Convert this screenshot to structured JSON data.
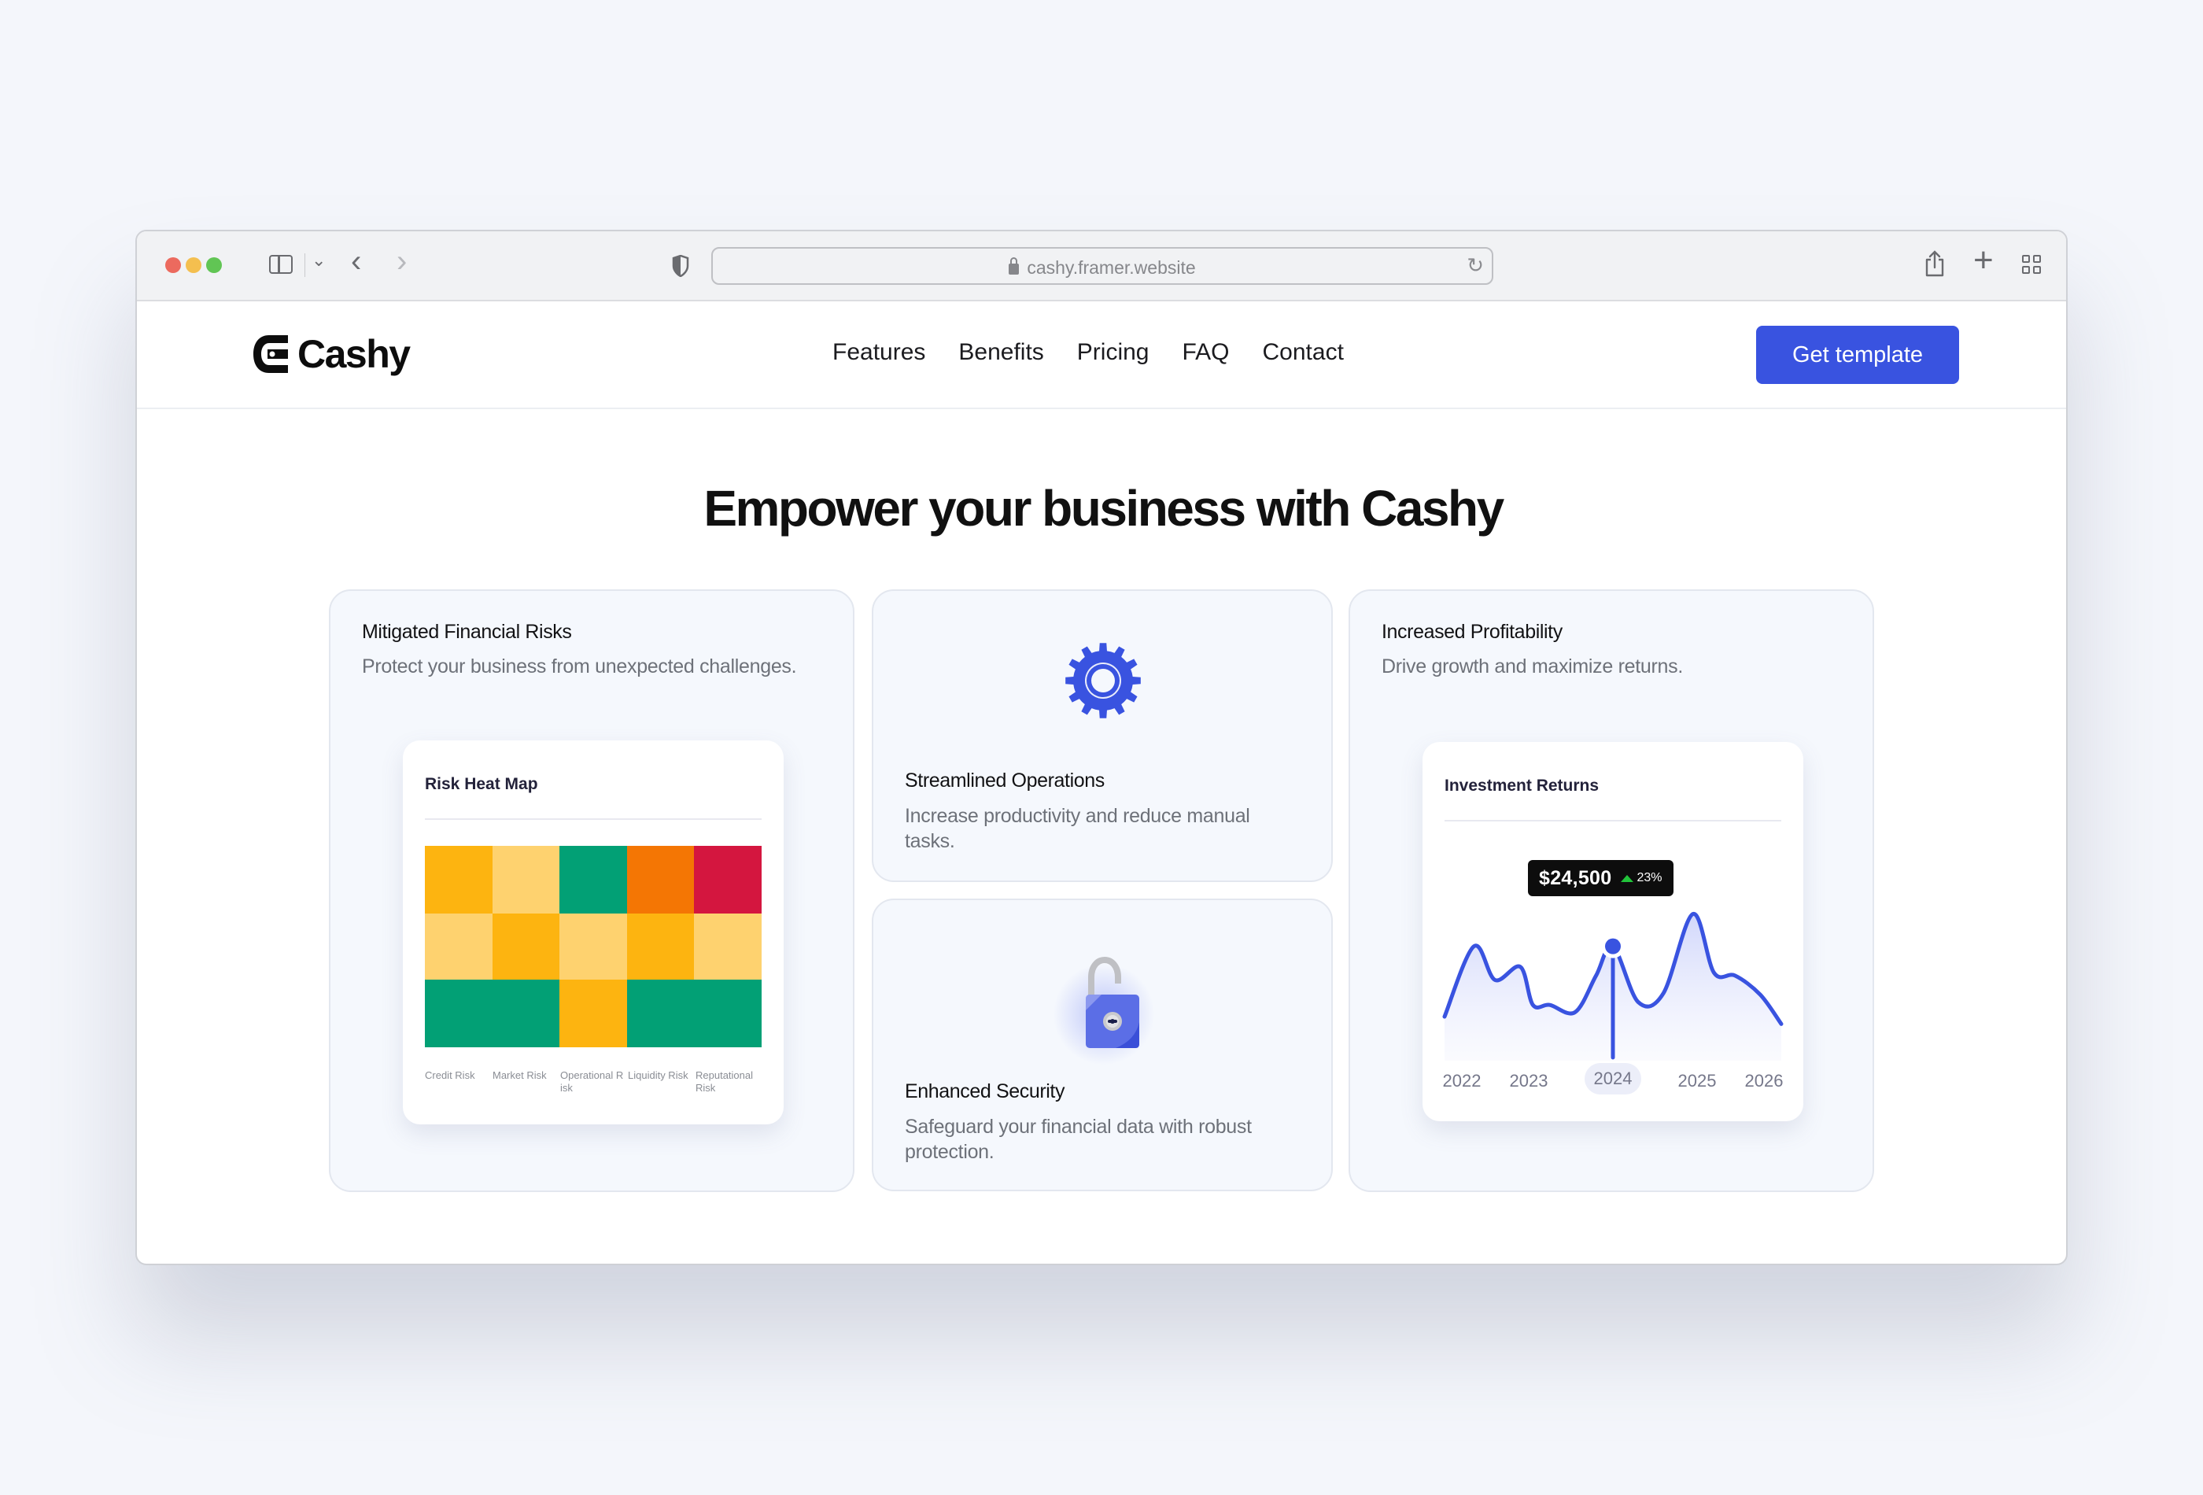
{
  "browser": {
    "url": "cashy.framer.website",
    "icons": [
      "sidebar-icon",
      "chevron-down-icon",
      "back-icon",
      "forward-icon",
      "shield-icon",
      "lock-icon",
      "reload-icon",
      "share-icon",
      "plus-icon",
      "tabs-overview-icon"
    ]
  },
  "nav": {
    "brand": "Cashy",
    "links": [
      "Features",
      "Benefits",
      "Pricing",
      "FAQ",
      "Contact"
    ],
    "cta": "Get template",
    "accent": "#3953e0"
  },
  "section": {
    "title": "Empower your business with Cashy"
  },
  "cards": {
    "risk": {
      "title": "Mitigated Financial Risks",
      "desc": "Protect your business from unexpected challenges.",
      "widget_title": "Risk Heat Map"
    },
    "ops": {
      "title": "Streamlined Operations",
      "desc": "Increase productivity and reduce manual tasks.",
      "icon": "gear-icon"
    },
    "security": {
      "title": "Enhanced Security",
      "desc": "Safeguard your financial data with robust protection.",
      "icon": "padlock-icon"
    },
    "profit": {
      "title": "Increased Profitability",
      "desc": "Drive growth and maximize returns.",
      "widget_title": "Investment Returns",
      "tooltip_value": "$24,500",
      "tooltip_change": "23%"
    }
  },
  "chart_data": [
    {
      "type": "heatmap",
      "title": "Risk Heat Map",
      "categories": [
        "Credit Risk",
        "Market Risk",
        "Operational Risk",
        "Liquidity Risk",
        "Reputational Risk"
      ],
      "rows": 3,
      "colors": {
        "high": "#d4163f",
        "elevated": "#f47604",
        "medium": "#fdb410",
        "low": "#fed26f",
        "safe": "#02a075"
      },
      "cells": [
        [
          "medium",
          "low",
          "safe",
          "elevated",
          "high"
        ],
        [
          "low",
          "medium",
          "low",
          "medium",
          "low"
        ],
        [
          "safe",
          "safe",
          "medium",
          "safe",
          "safe"
        ]
      ]
    },
    {
      "type": "area",
      "title": "Investment Returns",
      "x_ticks": [
        "2022",
        "2023",
        "2024",
        "2025",
        "2026"
      ],
      "highlighted_tick": "2024",
      "highlight": {
        "x": 2024.0,
        "label": "$24,500",
        "change": "23%",
        "direction": "up"
      },
      "series": [
        {
          "name": "Returns",
          "color": "#3953e0",
          "x": [
            2022.0,
            2022.35,
            2022.6,
            2022.9,
            2023.05,
            2023.25,
            2023.55,
            2023.8,
            2024.0,
            2024.3,
            2024.6,
            2024.95,
            2025.2,
            2025.45,
            2025.75,
            2026.0
          ],
          "y": [
            0.3,
            0.78,
            0.55,
            0.64,
            0.38,
            0.38,
            0.33,
            0.58,
            0.78,
            0.4,
            0.46,
            1.0,
            0.6,
            0.58,
            0.45,
            0.25
          ]
        }
      ],
      "ylim": [
        0,
        1.1
      ],
      "grid": false
    }
  ]
}
